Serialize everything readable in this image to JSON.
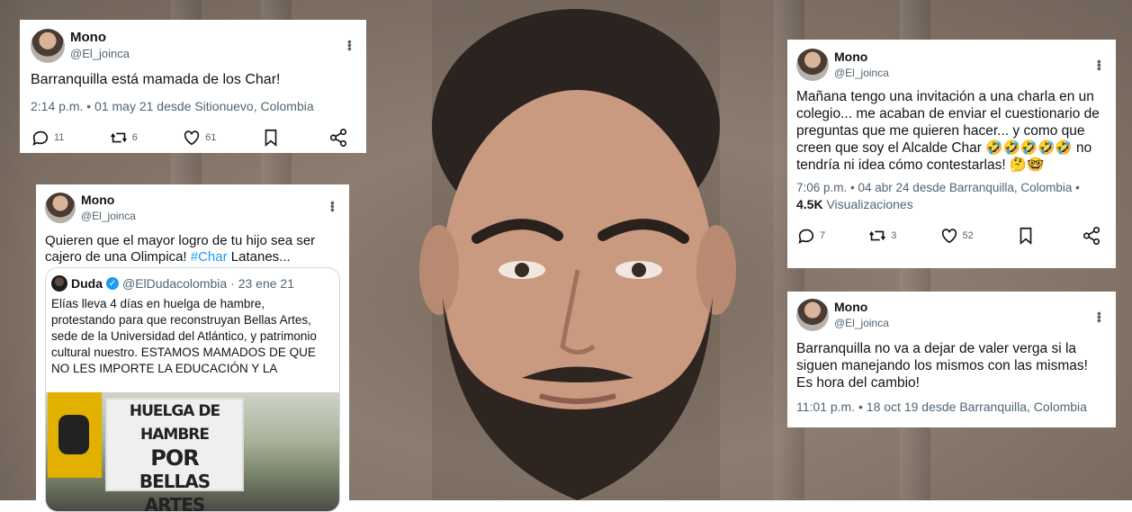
{
  "tweets": [
    {
      "name": "Mono",
      "handle": "@El_joinca",
      "text": "Barranquilla está mamada de los Char!",
      "meta": "2:14 p.m. • 01 may 21 desde Sitionuevo, Colombia",
      "replies": "11",
      "retweets": "6",
      "likes": "61"
    },
    {
      "name": "Mono",
      "handle": "@El_joinca",
      "text_before": "Quieren que el mayor logro de tu hijo sea ser cajero de una Olimpica! ",
      "hashtag": "#Char",
      "text_after": " Latanes...",
      "quote": {
        "name": "Duda",
        "handle": "@ElDudacolombia",
        "date": "· 23 ene 21",
        "text": "Elías lleva 4 días en huelga de hambre, protestando para que reconstruyan Bellas Artes, sede de la Universidad del Atlántico, y patrimonio cultural nuestro.  ESTAMOS MAMADOS DE QUE NO LES IMPORTE LA EDUCACIÓN Y LA CULTUR...",
        "banner_line1": "HUELGA DE HAMBRE",
        "banner_line2": "POR",
        "banner_line3": "BELLAS ARTES"
      }
    },
    {
      "name": "Mono",
      "handle": "@El_joinca",
      "text": "Mañana tengo una invitación a una charla en un colegio... me acaban de enviar el cuestionario de preguntas que me quieren hacer... y como que creen que soy el Alcalde Char 🤣🤣🤣🤣🤣 no tendría ni idea cómo contestarlas! 🤔🤓",
      "meta": "7:06 p.m. • 04 abr 24 desde Barranquilla, Colombia •",
      "views_count": "4.5K",
      "views_label": "Visualizaciones",
      "replies": "7",
      "retweets": "3",
      "likes": "52"
    },
    {
      "name": "Mono",
      "handle": "@El_joinca",
      "text": "Barranquilla no va a dejar de valer verga si la siguen manejando los mismos con las mismas! Es hora del cambio!",
      "meta": "11:01 p.m. • 18 oct 19 desde Barranquilla, Colombia"
    }
  ],
  "icons": [
    "reply-icon",
    "retweet-icon",
    "like-icon",
    "bookmark-icon",
    "share-icon",
    "more-icon",
    "verified-icon"
  ],
  "colors": {
    "link": "#1d9bf0",
    "muted": "#536471",
    "text": "#0f1419"
  }
}
